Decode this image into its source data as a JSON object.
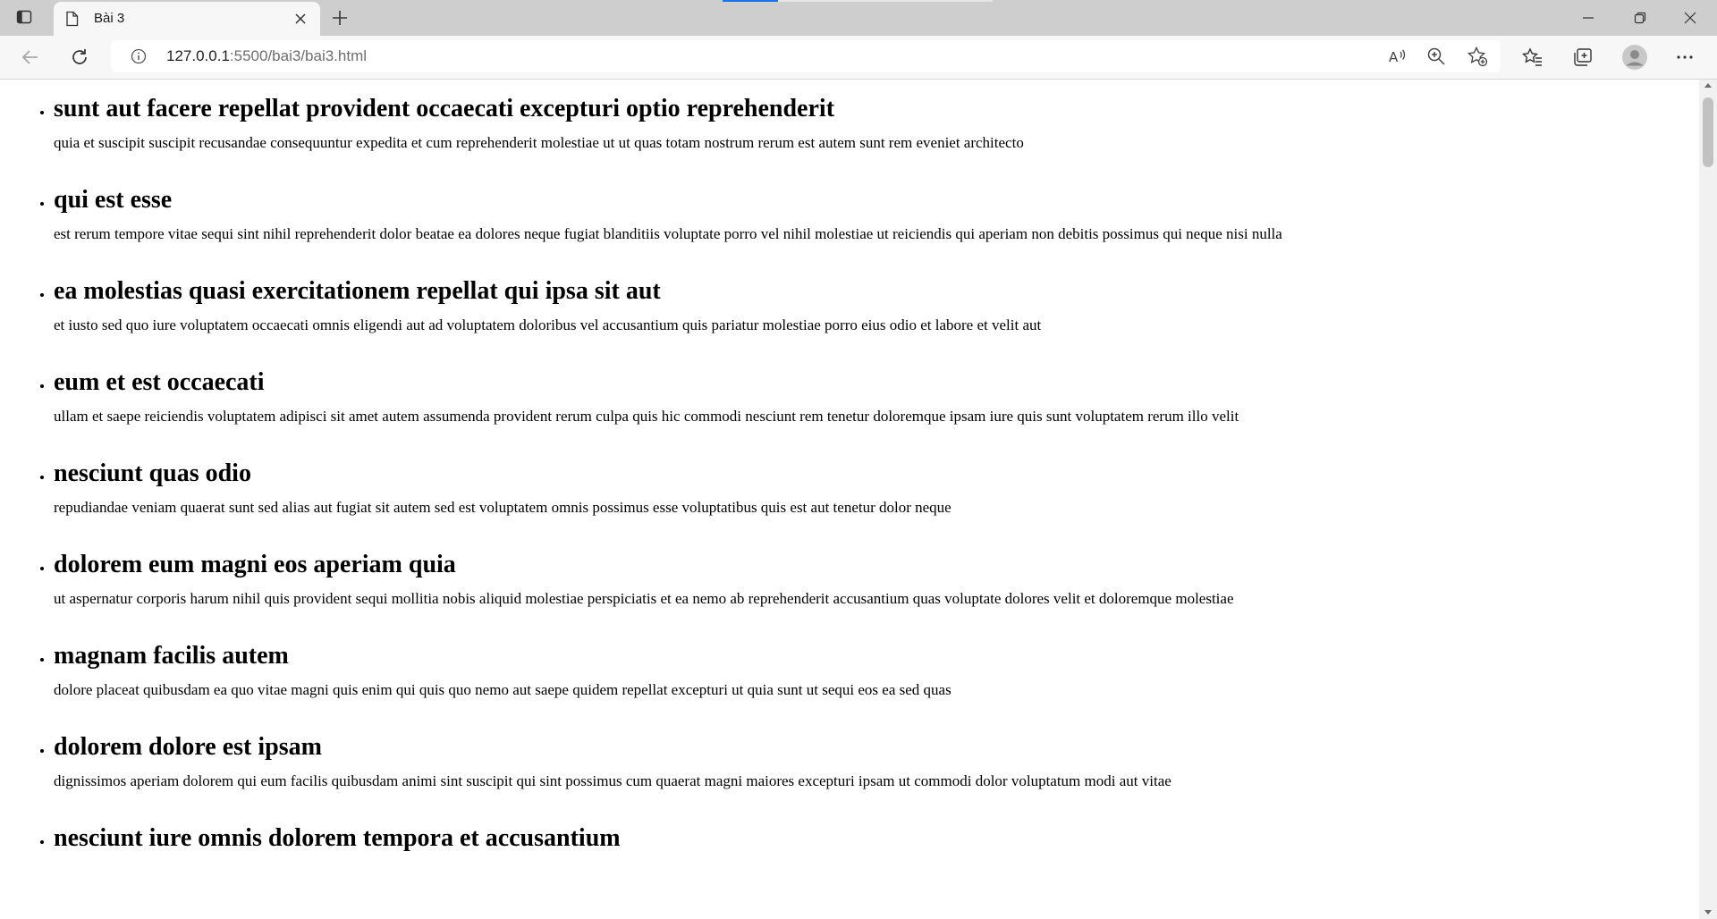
{
  "browser": {
    "tab_title": "Bài 3",
    "url_host": "127.0.0.1",
    "url_rest": ":5500/bai3/bai3.html",
    "icons": [
      "tab-actions-icon",
      "page-icon",
      "close-icon",
      "plus-icon",
      "minimize-icon",
      "restore-icon",
      "close-window-icon",
      "back-icon",
      "refresh-icon",
      "info-icon",
      "read-aloud-icon",
      "zoom-icon",
      "add-favorite-icon",
      "favorites-icon",
      "collections-icon",
      "profile-icon",
      "more-icon"
    ]
  },
  "posts": [
    {
      "title": "sunt aut facere repellat provident occaecati excepturi optio reprehenderit",
      "body": "quia et suscipit suscipit recusandae consequuntur expedita et cum reprehenderit molestiae ut ut quas totam nostrum rerum est autem sunt rem eveniet architecto"
    },
    {
      "title": "qui est esse",
      "body": "est rerum tempore vitae sequi sint nihil reprehenderit dolor beatae ea dolores neque fugiat blanditiis voluptate porro vel nihil molestiae ut reiciendis qui aperiam non debitis possimus qui neque nisi nulla"
    },
    {
      "title": "ea molestias quasi exercitationem repellat qui ipsa sit aut",
      "body": "et iusto sed quo iure voluptatem occaecati omnis eligendi aut ad voluptatem doloribus vel accusantium quis pariatur molestiae porro eius odio et labore et velit aut"
    },
    {
      "title": "eum et est occaecati",
      "body": "ullam et saepe reiciendis voluptatem adipisci sit amet autem assumenda provident rerum culpa quis hic commodi nesciunt rem tenetur doloremque ipsam iure quis sunt voluptatem rerum illo velit"
    },
    {
      "title": "nesciunt quas odio",
      "body": "repudiandae veniam quaerat sunt sed alias aut fugiat sit autem sed est voluptatem omnis possimus esse voluptatibus quis est aut tenetur dolor neque"
    },
    {
      "title": "dolorem eum magni eos aperiam quia",
      "body": "ut aspernatur corporis harum nihil quis provident sequi mollitia nobis aliquid molestiae perspiciatis et ea nemo ab reprehenderit accusantium quas voluptate dolores velit et doloremque molestiae"
    },
    {
      "title": "magnam facilis autem",
      "body": "dolore placeat quibusdam ea quo vitae magni quis enim qui quis quo nemo aut saepe quidem repellat excepturi ut quia sunt ut sequi eos ea sed quas"
    },
    {
      "title": "dolorem dolore est ipsam",
      "body": "dignissimos aperiam dolorem qui eum facilis quibusdam animi sint suscipit qui sint possimus cum quaerat magni maiores excepturi ipsam ut commodi dolor voluptatum modi aut vitae"
    },
    {
      "title": "nesciunt iure omnis dolorem tempora et accusantium",
      "body": ""
    }
  ]
}
